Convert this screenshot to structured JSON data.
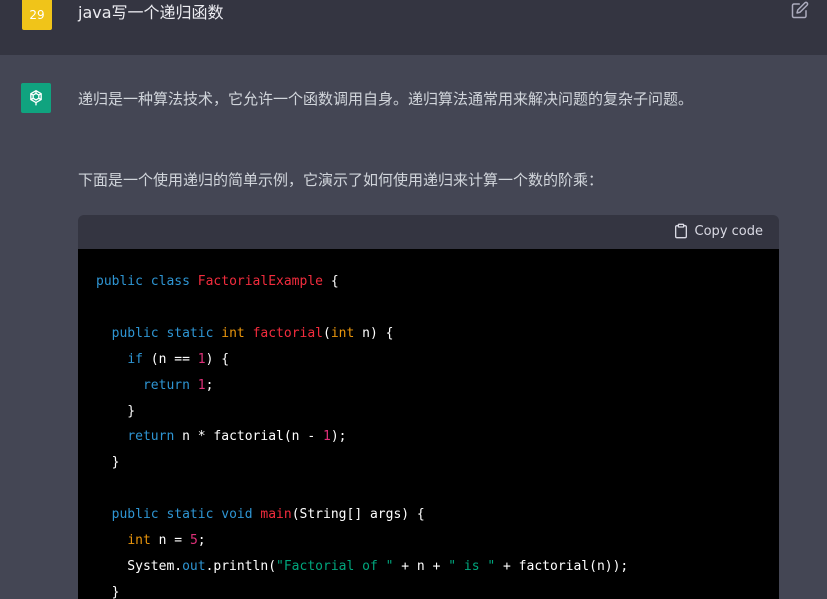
{
  "user": {
    "avatar_label": "29",
    "message": "java写一个递归函数"
  },
  "assistant": {
    "paragraph1": "递归是一种算法技术，它允许一个函数调用自身。递归算法通常用来解决问题的复杂子问题。",
    "paragraph2": "下面是一个使用递归的简单示例，它演示了如何使用递归来计算一个数的阶乘："
  },
  "code_block": {
    "copy_label": "Copy code",
    "lines": [
      "public class FactorialExample {",
      "",
      "  public static int factorial(int n) {",
      "    if (n == 1) {",
      "      return 1;",
      "    }",
      "    return n * factorial(n - 1);",
      "  }",
      "",
      "  public static void main(String[] args) {",
      "    int n = 5;",
      "    System.out.println(\"Factorial of \" + n + \" is \" + factorial(n));",
      "  }"
    ]
  },
  "colors": {
    "user_avatar": "#f0c419",
    "bot_avatar": "#10a37f",
    "background_user": "#343541",
    "background_bot": "#444654"
  }
}
